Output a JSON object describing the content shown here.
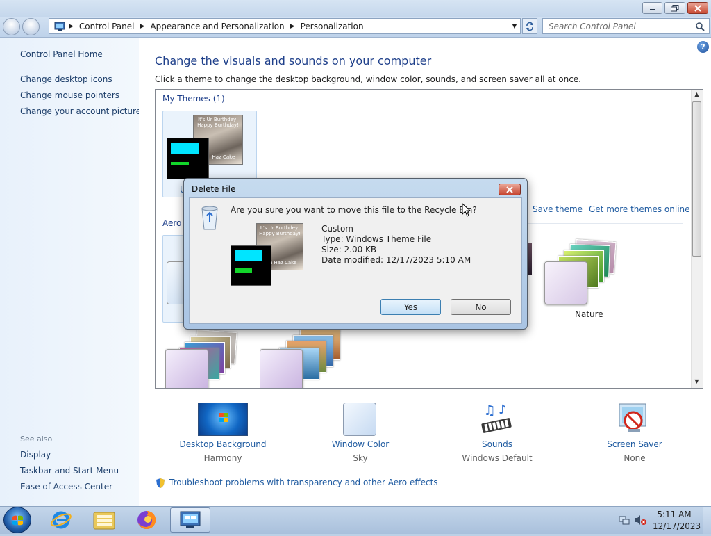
{
  "window": {
    "search_placeholder": "Search Control Panel",
    "breadcrumbs": [
      "Control Panel",
      "Appearance and Personalization",
      "Personalization"
    ]
  },
  "sidebar": {
    "home": "Control Panel Home",
    "tasks": [
      "Change desktop icons",
      "Change mouse pointers",
      "Change your account picture"
    ],
    "see_also_label": "See also",
    "see_also": [
      "Display",
      "Taskbar and Start Menu",
      "Ease of Access Center"
    ]
  },
  "main": {
    "title": "Change the visuals and sounds on your computer",
    "subtitle": "Click a theme to change the desktop background, window color, sounds, and screen saver all at once.",
    "my_themes_label": "My Themes (1)",
    "aero_label_partial": "Aero T",
    "custom_label_partial": "U",
    "save_theme": "Save theme",
    "get_more": "Get more themes online",
    "nature_label": "Nature",
    "settings": [
      {
        "label": "Desktop Background",
        "value": "Harmony",
        "icon": "harmony-wallpaper-icon"
      },
      {
        "label": "Window Color",
        "value": "Sky",
        "icon": "window-color-swatch-icon"
      },
      {
        "label": "Sounds",
        "value": "Windows Default",
        "icon": "sounds-music-icon"
      },
      {
        "label": "Screen Saver",
        "value": "None",
        "icon": "screensaver-none-icon"
      }
    ],
    "troubleshoot": "Troubleshoot problems with transparency and other Aero effects"
  },
  "dialog": {
    "title": "Delete File",
    "question": "Are you sure you want to move this file to the Recycle Bin?",
    "file_name": "Custom",
    "file_type": "Type: Windows Theme File",
    "file_size": "Size: 2.00 KB",
    "file_modified": "Date modified: 12/17/2023 5:10 AM",
    "yes": "Yes",
    "no": "No",
    "image_text_top": "It's Ur Burthdey! Happy Burthday!",
    "image_text_bottom": "Can Haz Cake"
  },
  "taskbar": {
    "apps": [
      "internet-explorer-icon",
      "file-explorer-icon",
      "firefox-icon",
      "control-panel-icon"
    ],
    "time": "5:11 AM",
    "date": "12/17/2023"
  },
  "colors": {
    "link": "#1e5aa0",
    "heading": "#1e3f8a",
    "frame": "#c5d7ec",
    "cyan_bar": "#00e5ff",
    "green_bar": "#12d62a"
  }
}
